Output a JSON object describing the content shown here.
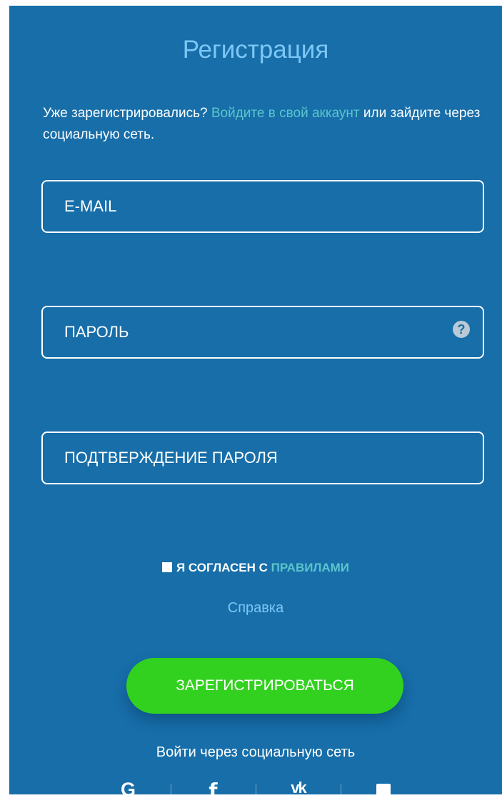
{
  "form": {
    "title": "Регистрация",
    "intro": {
      "prefix": "Уже зарегистрировались? ",
      "login_link": "Войдите в свой аккаунт",
      "suffix": " или зайдите через социальную сеть."
    },
    "email": {
      "placeholder": "E-MAIL",
      "value": ""
    },
    "password": {
      "placeholder": "ПАРОЛЬ",
      "value": "",
      "help_icon_text": "?"
    },
    "confirm": {
      "placeholder": "ПОДТВЕРЖДЕНИЕ ПАРОЛЯ",
      "value": ""
    },
    "agree": {
      "checked": false,
      "text": "Я СОГЛАСЕН С ",
      "rules_link": "ПРАВИЛАМИ"
    },
    "help_link": "Справка",
    "submit_label": "ЗАРЕГИСТРИРОВАТЬСЯ",
    "social_label": "Войти через социальную сеть"
  },
  "social": [
    {
      "icon": "google-icon",
      "glyph": "G"
    },
    {
      "icon": "facebook-icon",
      "glyph": "f"
    },
    {
      "icon": "vk-icon",
      "glyph": "vk"
    },
    {
      "icon": "chat-icon",
      "glyph": ""
    }
  ],
  "colors": {
    "panel_bg": "#176ea9",
    "title": "#7cc7f5",
    "link": "#5cc5cc",
    "button": "#33d11f",
    "text": "#ffffff"
  }
}
